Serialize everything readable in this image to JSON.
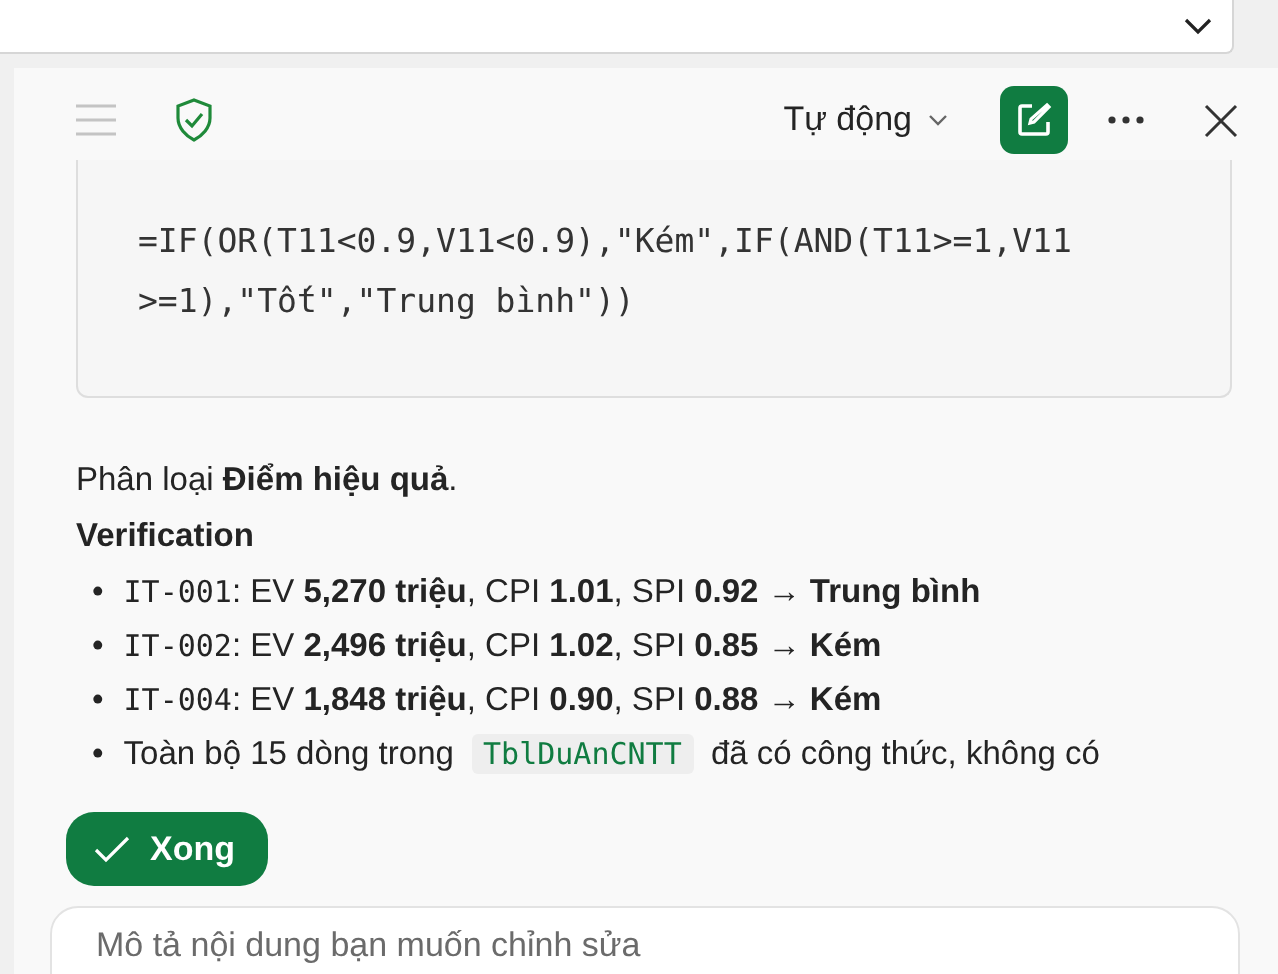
{
  "header": {
    "mode": "Tự động"
  },
  "code_block": {
    "lines": [
      "=IF(OR(T11<0.9,V11<0.9),\"Kém\",IF(AND(T11>=1,V11",
      ">=1),\"Tốt\",\"Trung bình\"))"
    ]
  },
  "summary": "Phân loại **Điểm hiệu quả**.",
  "heading": "Verification",
  "bullets": [
    {
      "kind": "code_lead",
      "marker": "•",
      "code": "IT-001",
      "text": ": EV **5,270 triệu**, CPI **1.01**, SPI **0.92** → **Trung bình**"
    },
    {
      "kind": "code_lead",
      "marker": "•",
      "code": "IT-002",
      "text": ": EV **2,496 triệu**, CPI **1.02**, SPI **0.85** → **Kém**"
    },
    {
      "kind": "code_lead",
      "marker": "•",
      "code": "IT-004",
      "text": ": EV **1,848 triệu**, CPI **0.90**, SPI **0.88** → **Kém**"
    },
    {
      "kind": "inline_code",
      "marker": "•",
      "before": "Toàn bộ 15 dòng trong",
      "code": "TblDuAnCNTT",
      "after": "đã có công thức, không có"
    }
  ],
  "done_button": "Xong",
  "prompt": {
    "placeholder": "Mô tả nội dung bạn muốn chỉnh sửa"
  }
}
